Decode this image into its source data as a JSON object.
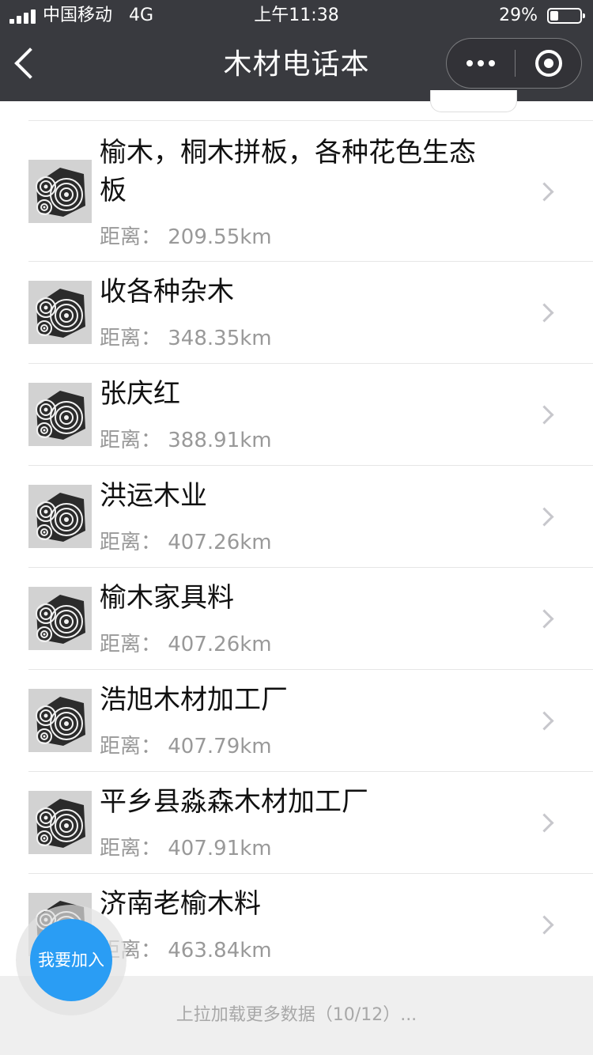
{
  "status_bar": {
    "carrier": "中国移动",
    "network": "4G",
    "time": "上午11:38",
    "battery": "29%",
    "battery_level": 0.29
  },
  "nav": {
    "title": "木材电话本",
    "back_icon": "chevron-left-icon",
    "more_icon": "more-dots-icon",
    "close_icon": "target-close-icon"
  },
  "list": {
    "items": [
      {
        "name": "榆木，桐木拼板，各种花色生态板",
        "distance": "距离： 209.55km"
      },
      {
        "name": "收各种杂木",
        "distance": "距离： 348.35km"
      },
      {
        "name": "张庆红",
        "distance": "距离： 388.91km"
      },
      {
        "name": "洪运木业",
        "distance": "距离： 407.26km"
      },
      {
        "name": "榆木家具料",
        "distance": "距离： 407.26km"
      },
      {
        "name": "浩旭木材加工厂",
        "distance": "距离： 407.79km"
      },
      {
        "name": "平乡县淼森木材加工厂",
        "distance": "距离： 407.91km"
      },
      {
        "name": "济南老榆木料",
        "distance": "距离： 463.84km"
      }
    ]
  },
  "fab": {
    "label": "我要加入"
  },
  "footer": {
    "load_more": "上拉加载更多数据（10/12）..."
  },
  "colors": {
    "nav_bg": "#393a3f",
    "fab": "#2a9df4",
    "footer_bg": "#efefef"
  }
}
